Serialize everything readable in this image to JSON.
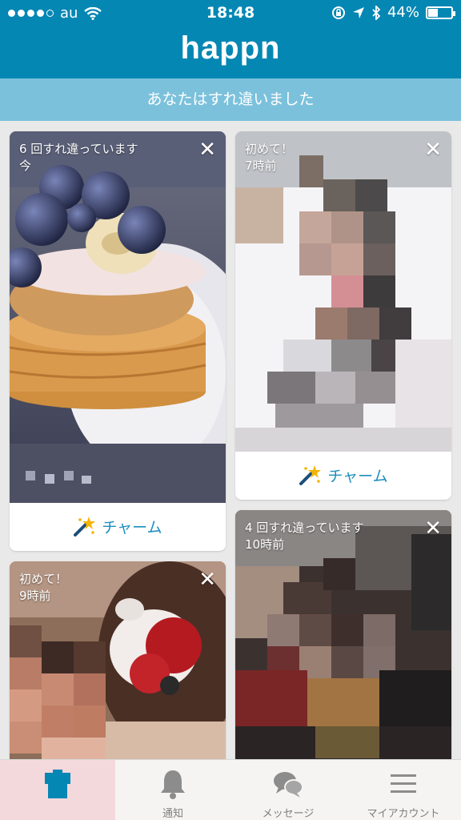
{
  "status_bar": {
    "carrier": "au",
    "time": "18:48",
    "battery_text": "44%",
    "battery_level": 0.44
  },
  "header": {
    "logo": "happn"
  },
  "subheader": {
    "text": "あなたはすれ違いました"
  },
  "cards": [
    {
      "line1": "6 回すれ違っています",
      "line2": "今",
      "charm": "チャーム"
    },
    {
      "line1": "初めて！",
      "line2": "7時前",
      "charm": "チャーム"
    },
    {
      "line1": "4 回すれ違っています",
      "line2": "10時前"
    },
    {
      "line1": "初めて！",
      "line2": "9時前"
    }
  ],
  "tab_bar": {
    "tabs": [
      {
        "label": "",
        "icon": "home-icon"
      },
      {
        "label": "通知",
        "icon": "bell-icon"
      },
      {
        "label": "メッセージ",
        "icon": "chat-bubbles-icon"
      },
      {
        "label": "マイアカウント",
        "icon": "menu-icon"
      }
    ]
  },
  "colors": {
    "brand": "#0587b4",
    "subheader": "#7cc1dc",
    "charm_text": "#1d8fbd"
  }
}
